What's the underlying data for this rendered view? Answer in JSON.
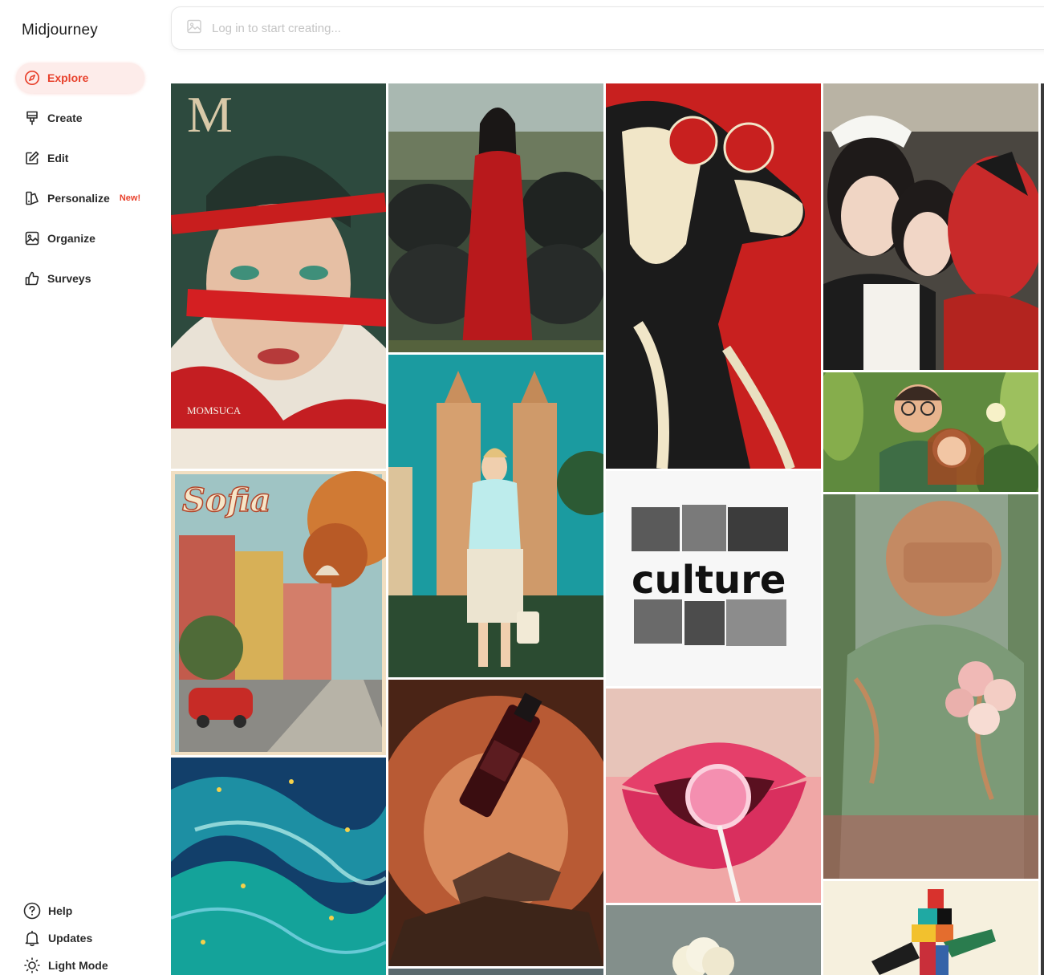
{
  "app": {
    "title": "Midjourney"
  },
  "nav": {
    "explore": "Explore",
    "create": "Create",
    "edit": "Edit",
    "personalize": "Personalize",
    "personalize_badge": "New!",
    "organize": "Organize",
    "surveys": "Surveys"
  },
  "footer": {
    "help": "Help",
    "updates": "Updates",
    "light_mode": "Light Mode"
  },
  "prompt": {
    "placeholder": "Log in to start creating..."
  },
  "gallery": {
    "tiles": [
      {
        "id": "woman-red-ribbon",
        "text_mark": "M",
        "caption": "MOMSUCA"
      },
      {
        "id": "woman-red-dress-wolves"
      },
      {
        "id": "cow-red-sunglasses"
      },
      {
        "id": "maids-and-spiderman"
      },
      {
        "id": "sofia-poster",
        "text_mark": "Sofia"
      },
      {
        "id": "woman-skyscrapers"
      },
      {
        "id": "culture-collage",
        "text_mark": "culture"
      },
      {
        "id": "clay-figures-leaves"
      },
      {
        "id": "ocean-swirl"
      },
      {
        "id": "bottle-on-rock"
      },
      {
        "id": "lips-lollipop"
      },
      {
        "id": "robot-knight-roses"
      },
      {
        "id": "cauliflower"
      },
      {
        "id": "geometric-figure"
      }
    ]
  },
  "colors": {
    "accent": "#e8412c",
    "active_bg": "#fdecea"
  }
}
